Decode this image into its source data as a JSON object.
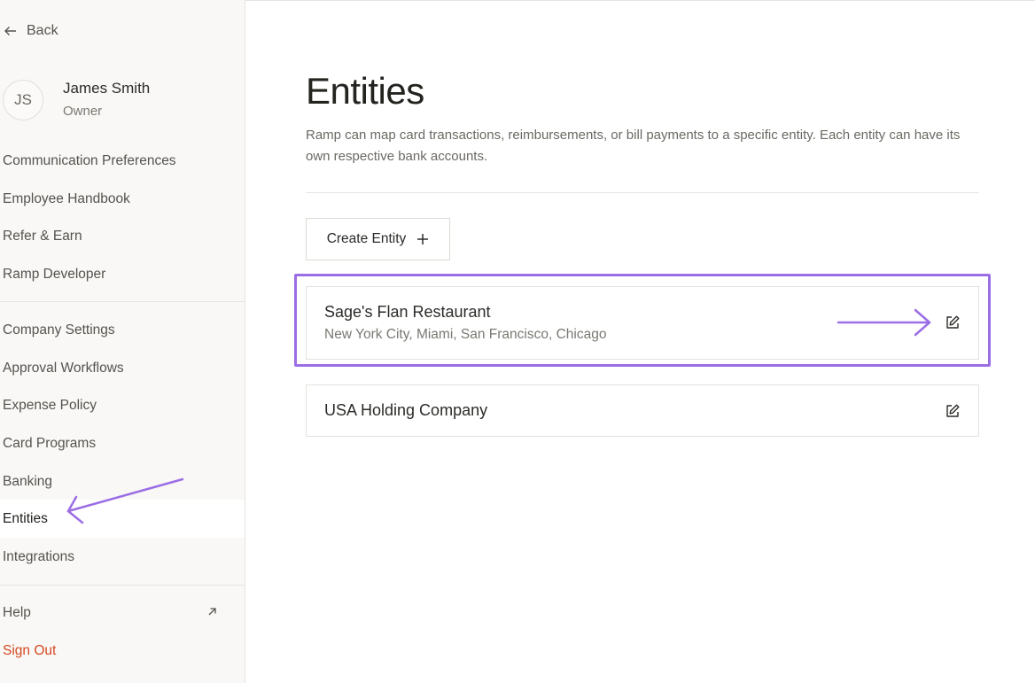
{
  "sidebar": {
    "back_label": "Back",
    "user": {
      "initials": "JS",
      "name": "James Smith",
      "role": "Owner"
    },
    "items": [
      {
        "label": "Communication Preferences"
      },
      {
        "label": "Employee Handbook"
      },
      {
        "label": "Refer & Earn"
      },
      {
        "label": "Ramp Developer"
      },
      {
        "label": "Company Settings"
      },
      {
        "label": "Approval Workflows"
      },
      {
        "label": "Expense Policy"
      },
      {
        "label": "Card Programs"
      },
      {
        "label": "Banking"
      },
      {
        "label": "Entities",
        "active": true
      },
      {
        "label": "Integrations"
      },
      {
        "label": "Help",
        "icon": "external-link-icon"
      },
      {
        "label": "Sign Out"
      }
    ]
  },
  "main": {
    "title": "Entities",
    "description": "Ramp can map card transactions, reimbursements, or bill payments to a specific entity. Each entity can have its own respective bank accounts.",
    "create_button_label": "Create Entity",
    "entities": [
      {
        "name": "Sage's Flan Restaurant",
        "locations": "New York City, Miami, San Francisco, Chicago"
      },
      {
        "name": "USA Holding Company"
      }
    ]
  },
  "colors": {
    "annotation_purple": "#9b6ee6",
    "sign_out_red": "#d4481f",
    "sidebar_bg": "#f9f8f6"
  },
  "icons": [
    "arrow-left-icon",
    "plus-icon",
    "edit-icon",
    "external-link-icon"
  ]
}
